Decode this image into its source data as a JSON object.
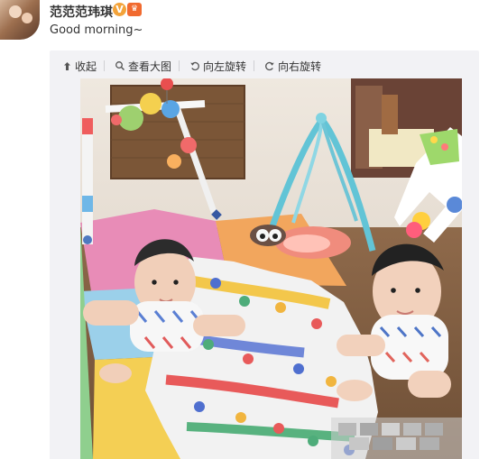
{
  "user": {
    "name": "范范范玮琪",
    "verified_mark": "V"
  },
  "post": {
    "text": "Good morning~"
  },
  "toolbar": {
    "items": [
      {
        "label": "收起",
        "icon": "collapse-icon"
      },
      {
        "label": "查看大图",
        "icon": "search-icon"
      },
      {
        "label": "向左旋转",
        "icon": "rotate-left-icon"
      },
      {
        "label": "向右旋转",
        "icon": "rotate-right-icon"
      }
    ]
  },
  "photo": {
    "subject": "two babies on a play mat"
  },
  "colors": {
    "panel_background": "#f2f2f5",
    "text": "#333333",
    "verified_badge": "#f3a33a",
    "vip_badge": "#f16a2f"
  }
}
